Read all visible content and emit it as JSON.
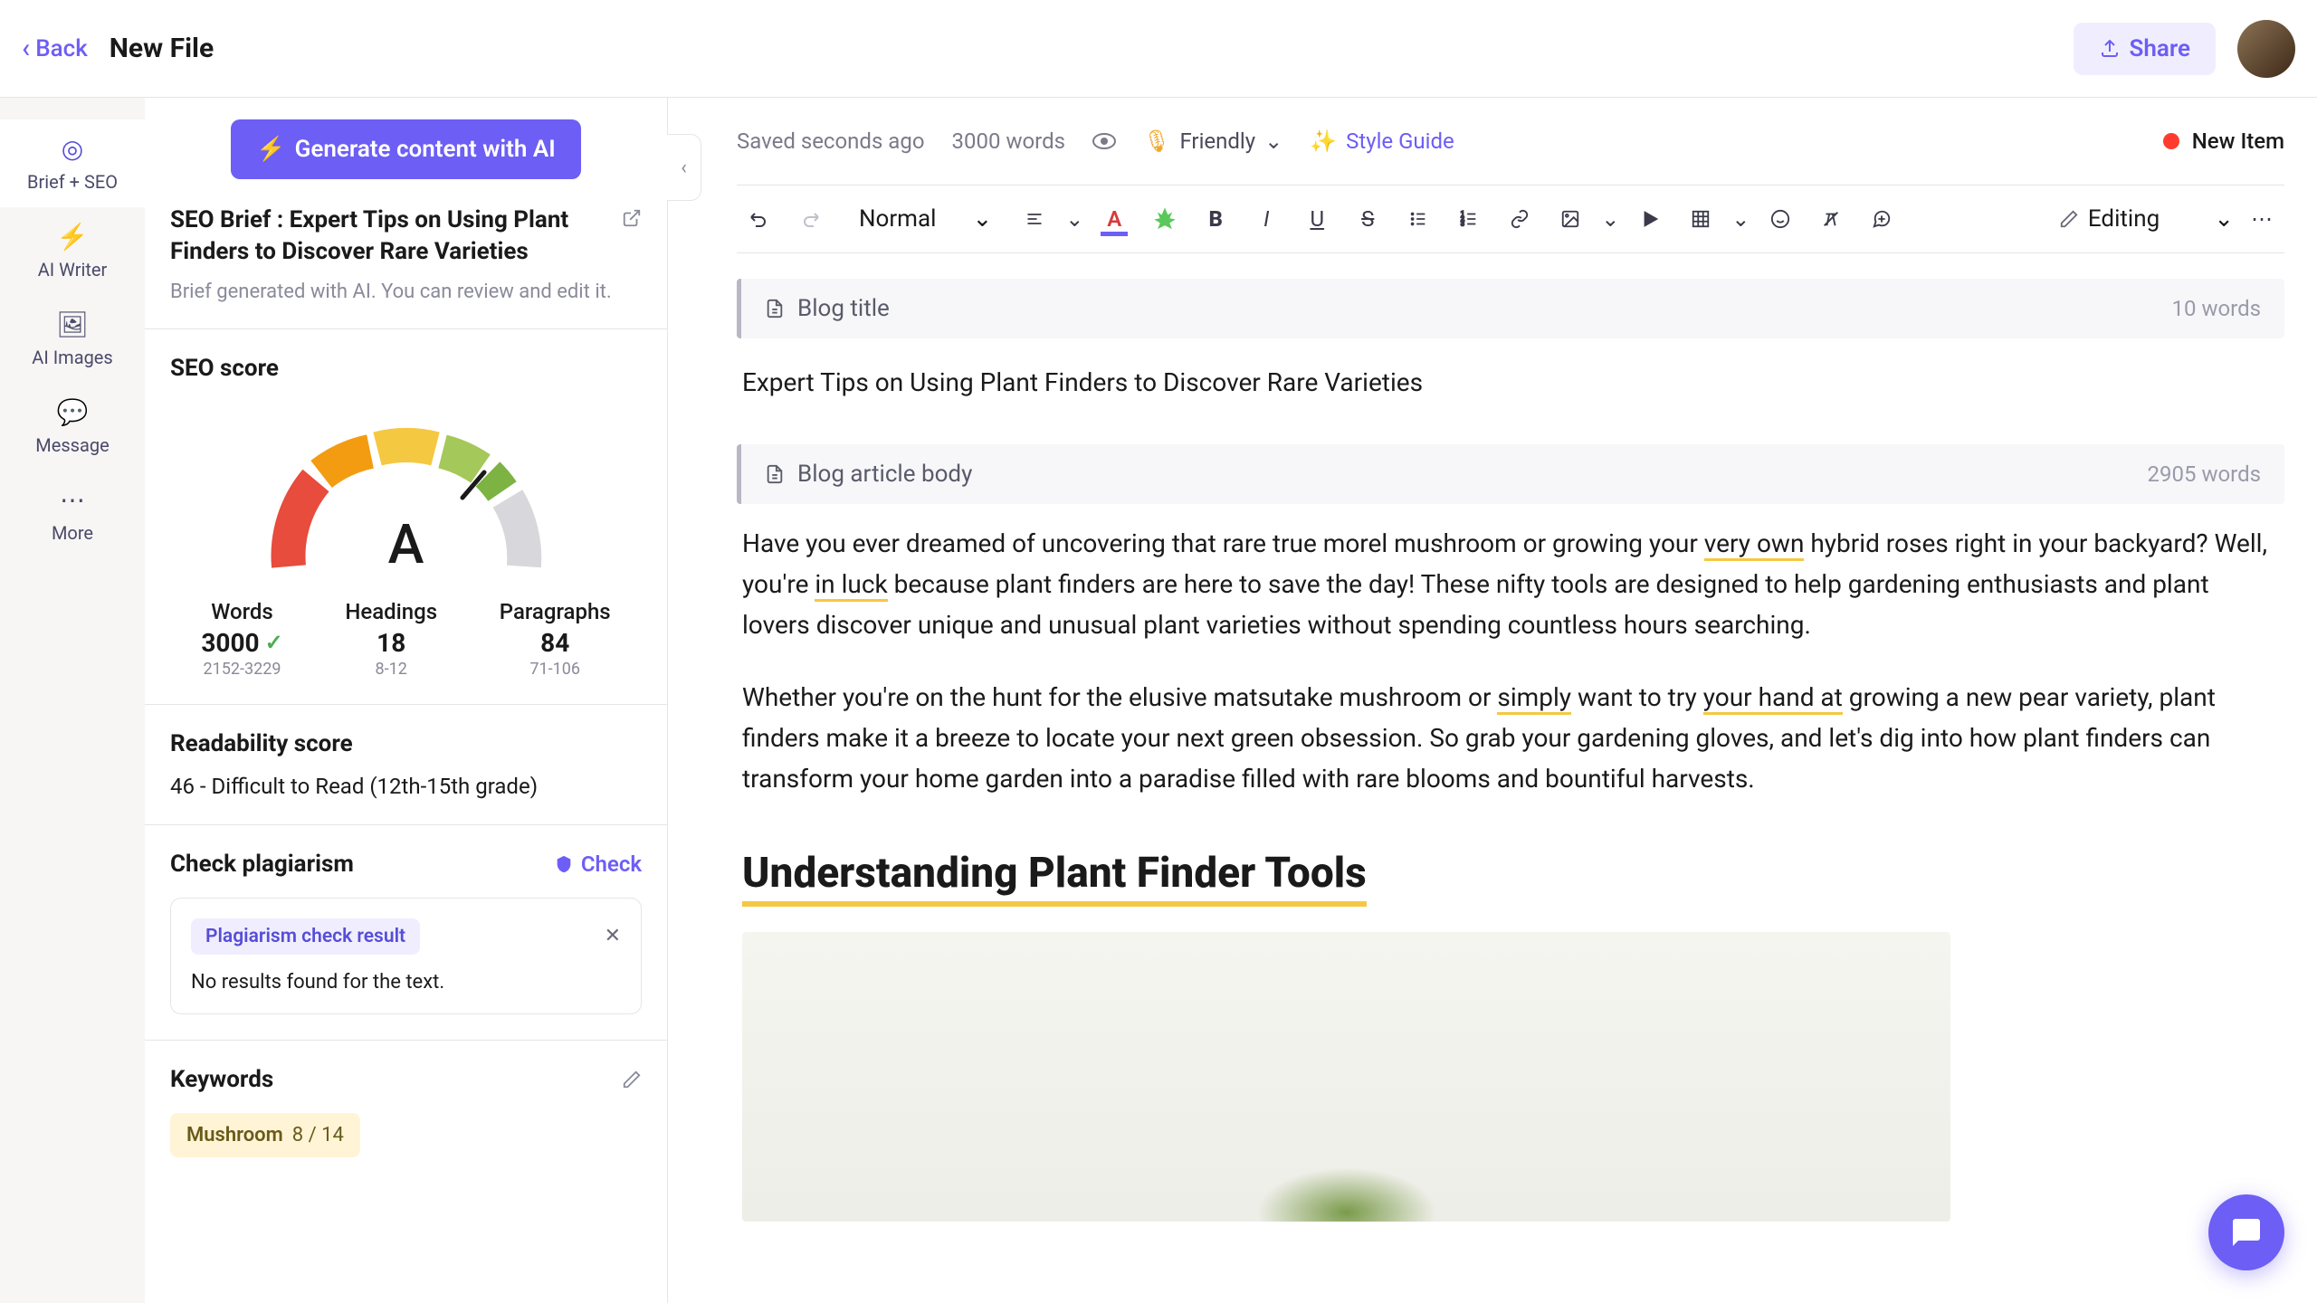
{
  "header": {
    "back": "Back",
    "title": "New File",
    "share": "Share"
  },
  "nav": {
    "items": [
      {
        "label": "Brief + SEO"
      },
      {
        "label": "AI Writer"
      },
      {
        "label": "AI Images"
      },
      {
        "label": "Message"
      },
      {
        "label": "More"
      }
    ]
  },
  "sidebar": {
    "generate": "Generate content with AI",
    "brief_title": "SEO Brief : Expert Tips on Using Plant Finders to Discover Rare Varieties",
    "brief_subtitle": "Brief generated with AI. You can review and edit it.",
    "seo_score_title": "SEO score",
    "gauge_letter": "A",
    "stats": {
      "words": {
        "label": "Words",
        "value": "3000",
        "range": "2152-3229"
      },
      "headings": {
        "label": "Headings",
        "value": "18",
        "range": "8-12"
      },
      "paragraphs": {
        "label": "Paragraphs",
        "value": "84",
        "range": "71-106"
      }
    },
    "readability_title": "Readability score",
    "readability_text": "46 - Difficult to Read (12th-15th grade)",
    "plagiarism_title": "Check plagiarism",
    "check": "Check",
    "plagiarism_badge": "Plagiarism check result",
    "plagiarism_result": "No results found for the text.",
    "keywords_title": "Keywords",
    "keyword": {
      "name": "Mushroom",
      "count": "8 / 14"
    }
  },
  "editor": {
    "saved": "Saved seconds ago",
    "word_count": "3000 words",
    "tone": "Friendly",
    "style_guide": "Style Guide",
    "status": "New Item",
    "format_select": "Normal",
    "editing_mode": "Editing",
    "title_block": {
      "label": "Blog title",
      "words": "10 words"
    },
    "title_text": "Expert Tips on Using Plant Finders to Discover Rare Varieties",
    "body_block": {
      "label": "Blog article body",
      "words": "2905 words"
    },
    "para1_a": "Have you ever dreamed of uncovering that rare true morel mushroom or growing your ",
    "para1_hl1": "very own",
    "para1_b": " hybrid roses right in your backyard? Well, you're ",
    "para1_hl2": "in luck",
    "para1_c": " because plant finders are here to save the day! These nifty tools are designed to help gardening enthusiasts and plant lovers discover unique and unusual plant varieties without spending countless hours searching.",
    "para2_a": "Whether you're on the hunt for the elusive matsutake mushroom or ",
    "para2_hl1": "simply",
    "para2_b": " want to try ",
    "para2_hl2": "your hand at",
    "para2_c": " growing a new pear variety, plant finders make it a breeze to locate your next green obsession. So grab your gardening gloves, and let's dig into how plant finders can transform your home garden into a paradise filled with rare blooms and bountiful harvests.",
    "h2": "Understanding Plant Finder Tools"
  }
}
